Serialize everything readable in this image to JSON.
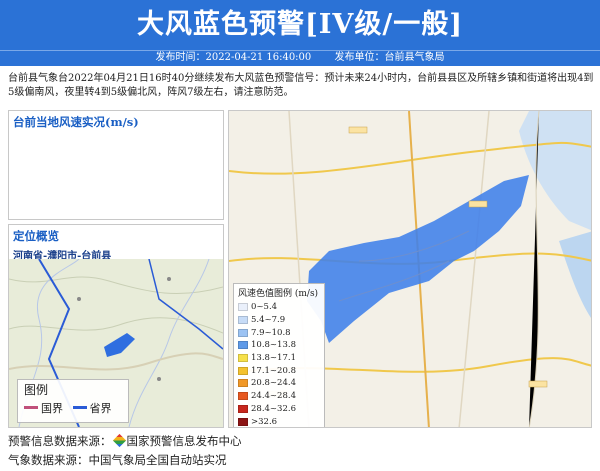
{
  "header": {
    "title": "大风蓝色预警[IV级/一般]",
    "publish_time": "发布时间：2022-04-21 16:40:00",
    "publisher": "发布单位：台前县气象局"
  },
  "description": "台前县气象台2022年04月21日16时40分继续发布大风蓝色预警信号：预计未来24小时内，台前县县区及所辖乡镇和街道将出现4到5级偏南风，夜里转4到5级偏北风，阵风7级左右，请注意防范。",
  "wind_panel": {
    "title": "台前当地风速实况(m/s)"
  },
  "location_panel": {
    "title": "定位概览",
    "region": "河南省-濮阳市-台前县",
    "legend_title": "图例",
    "legend_items": [
      {
        "label": "国界",
        "color": "#c0507a"
      },
      {
        "label": "省界",
        "color": "#2a5bd6"
      }
    ]
  },
  "map_legend": {
    "title": "风速色值图例 (m/s)",
    "items": [
      {
        "label": "0~5.4",
        "color": "#eaf0fb"
      },
      {
        "label": "5.4~7.9",
        "color": "#c7dcf7"
      },
      {
        "label": "7.9~10.8",
        "color": "#9cc3f3"
      },
      {
        "label": "10.8~13.8",
        "color": "#5f9ae8"
      },
      {
        "label": "13.8~17.1",
        "color": "#f6e04a"
      },
      {
        "label": "17.1~20.8",
        "color": "#f4c22e"
      },
      {
        "label": "20.8~24.4",
        "color": "#f19826"
      },
      {
        "label": "24.4~28.4",
        "color": "#e7581f"
      },
      {
        "label": "28.4~32.6",
        "color": "#c7271d"
      },
      {
        "label": ">32.6",
        "color": "#8c1414"
      }
    ]
  },
  "footer": {
    "line1_prefix": "预警信息数据来源：",
    "line1_source": "国家预警信息发布中心",
    "line2": "气象数据来源：中国气象局全国自动站实况"
  }
}
